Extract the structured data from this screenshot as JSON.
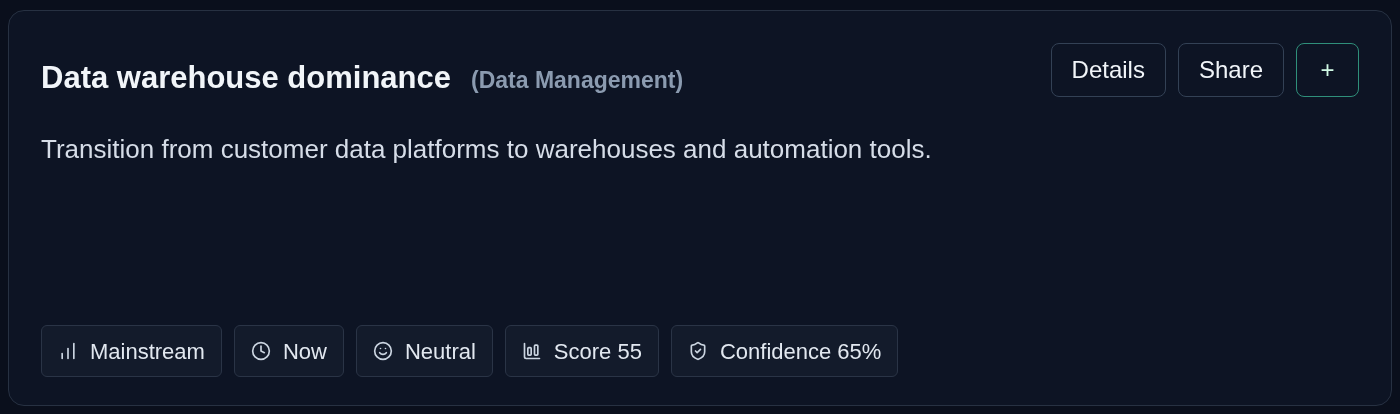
{
  "card": {
    "title": "Data warehouse dominance",
    "category": "(Data Management)",
    "description": "Transition from customer data platforms to warehouses and automation tools.",
    "actions": [
      {
        "label": "Details",
        "kind": "plain"
      },
      {
        "label": "Share",
        "kind": "plain"
      },
      {
        "label": "+",
        "kind": "accent"
      }
    ],
    "tags": [
      {
        "label": "Mainstream",
        "kind": "adoption"
      },
      {
        "label": "Now",
        "kind": "time"
      },
      {
        "label": "Neutral",
        "kind": "sentiment"
      },
      {
        "label": "Score 55",
        "kind": "score"
      },
      {
        "label": "Confidence 65%",
        "kind": "confidence"
      }
    ]
  }
}
